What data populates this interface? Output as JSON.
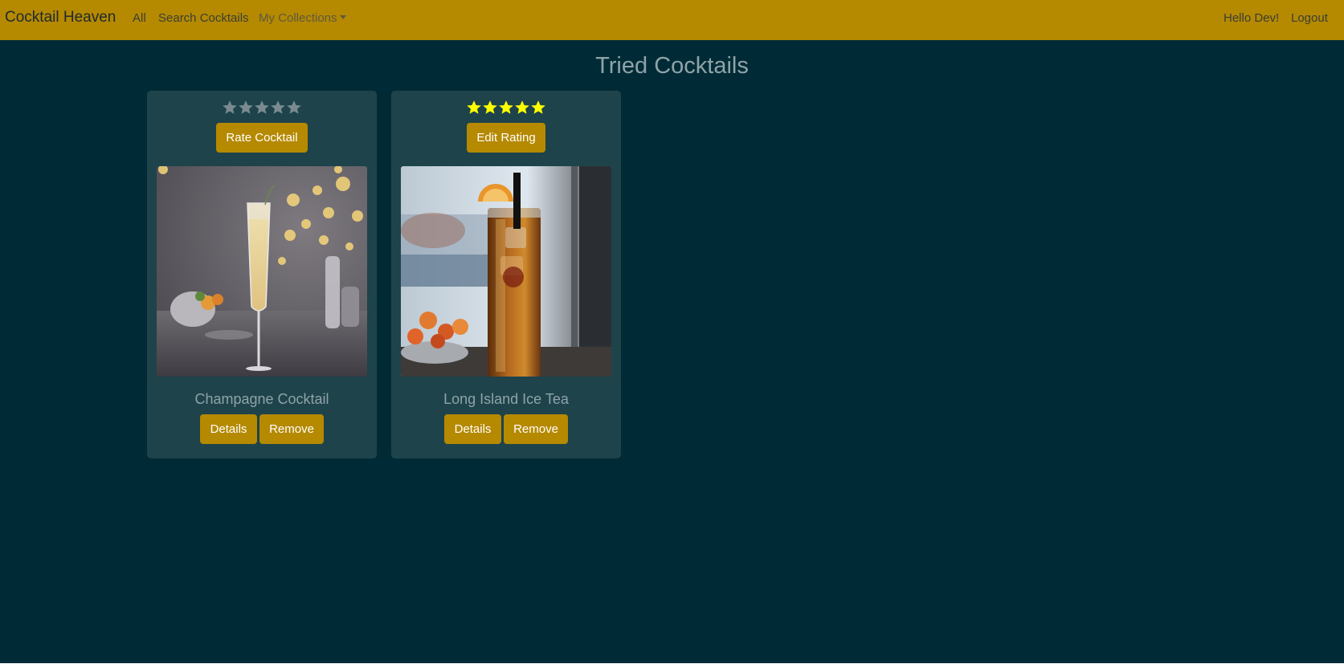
{
  "navbar": {
    "brand": "Cocktail Heaven",
    "links": {
      "all": "All",
      "search": "Search Cocktails",
      "collections": "My Collections"
    },
    "greeting": "Hello Dev!",
    "logout": "Logout"
  },
  "page": {
    "title": "Tried Cocktails"
  },
  "cards": [
    {
      "name": "Champagne Cocktail",
      "rating": 0,
      "max_rating": 5,
      "rate_label": "Rate Cocktail",
      "details_label": "Details",
      "remove_label": "Remove",
      "image": "champagne-flute-photo"
    },
    {
      "name": "Long Island Ice Tea",
      "rating": 5,
      "max_rating": 5,
      "rate_label": "Edit Rating",
      "details_label": "Details",
      "remove_label": "Remove",
      "image": "long-island-ice-tea-photo"
    }
  ],
  "colors": {
    "navbar": "#b58900",
    "background": "#002b36",
    "card": "#1e434b",
    "button": "#b58900",
    "star_filled": "#ffff00",
    "star_empty": "#7a8a8e"
  }
}
